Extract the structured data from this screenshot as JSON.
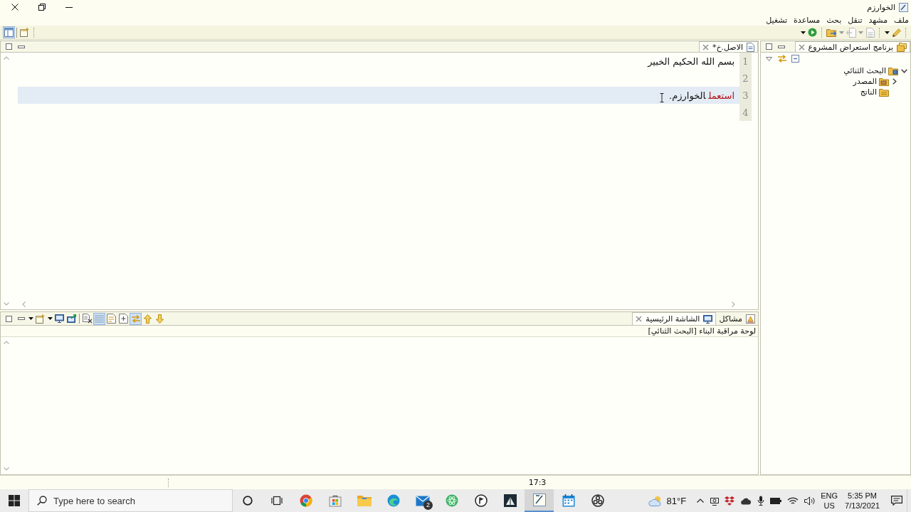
{
  "window": {
    "title": "الخوارزم"
  },
  "menu": [
    "ملف",
    "مشهد",
    "تنقل",
    "بحث",
    "مساعدة",
    "تشغيل"
  ],
  "toolbar": {
    "perspectives": [
      {
        "kind": "perspective-active",
        "pressed": true
      },
      {
        "kind": "perspective-open",
        "pressed": false
      }
    ],
    "groups": [
      {
        "items": [
          {
            "kind": "pencil",
            "disabled": false
          },
          {
            "kind": "caret",
            "disabled": false
          }
        ]
      },
      {
        "items": [
          {
            "kind": "page",
            "disabled": true
          },
          {
            "kind": "caret",
            "disabled": true
          },
          {
            "kind": "back",
            "disabled": true
          },
          {
            "kind": "caret",
            "disabled": true
          },
          {
            "kind": "folder-arrow",
            "disabled": false
          }
        ]
      },
      {
        "items": [
          {
            "kind": "run",
            "disabled": false
          },
          {
            "kind": "caret",
            "disabled": false
          }
        ]
      }
    ]
  },
  "editor": {
    "tabs": [
      {
        "label": "*الاصل.خ",
        "selected": true
      }
    ],
    "lines": [
      {
        "number": "1",
        "current": false,
        "tokens": [
          {
            "kind": "plain",
            "text": "بسم الله الحكيم الخبير"
          }
        ]
      },
      {
        "number": "2",
        "current": false
      },
      {
        "number": "3",
        "current": true,
        "tokens": [
          {
            "kind": "keyword",
            "text": "استعمل"
          },
          {
            "kind": "plain",
            "text": "الخوارزم."
          }
        ]
      },
      {
        "number": "4",
        "current": false
      }
    ]
  },
  "bottom_panel": {
    "toolbar": {
      "groups": [
        {
          "items": [
            {
              "kind": "caret",
              "pressed": false
            },
            {
              "kind": "new-console",
              "pressed": false
            },
            {
              "kind": "caret",
              "pressed": false
            },
            {
              "kind": "display",
              "pressed": false
            },
            {
              "kind": "open-console",
              "pressed": false
            }
          ]
        },
        {
          "items": [
            {
              "kind": "remove",
              "pressed": false
            },
            {
              "kind": "scroll-lock",
              "pressed": true
            },
            {
              "kind": "word-wrap",
              "pressed": false
            },
            {
              "kind": "pin",
              "pressed": false
            },
            {
              "kind": "link",
              "pressed": true
            },
            {
              "kind": "up",
              "pressed": false
            },
            {
              "kind": "down",
              "pressed": false
            }
          ]
        }
      ]
    },
    "tabs": [
      {
        "label": "مشاكل",
        "kind": "problems",
        "selected": false
      },
      {
        "label": "الشاشة الرئيسية",
        "kind": "console",
        "selected": true
      }
    ],
    "console_title": "لوحة مراقبة البناء [البحث الثنائي]"
  },
  "explorer": {
    "tabs": [
      {
        "label": "برنامج استعراض المشروع",
        "selected": true
      }
    ],
    "tree": [
      {
        "label": "البحث الثنائي",
        "kind": "project",
        "expandable": true,
        "expanded": true,
        "children": [
          {
            "label": "المصدر",
            "kind": "source-folder",
            "expandable": true,
            "expanded": false
          },
          {
            "label": "الناتج",
            "kind": "output-folder",
            "expandable": false,
            "expanded": false
          }
        ]
      }
    ]
  },
  "status_bar": {
    "position": "17:3"
  },
  "taskbar": {
    "search_placeholder": "Type here to search",
    "apps": [
      {
        "kind": "cortana",
        "active": false
      },
      {
        "kind": "task-view",
        "active": false
      },
      {
        "kind": "chrome",
        "active": false
      },
      {
        "kind": "store",
        "active": false
      },
      {
        "kind": "files",
        "active": false
      },
      {
        "kind": "edge",
        "active": false
      },
      {
        "kind": "mail",
        "active": false,
        "badge": "2"
      },
      {
        "kind": "atom",
        "active": false
      },
      {
        "kind": "coin",
        "active": false
      },
      {
        "kind": "reader",
        "active": false
      },
      {
        "kind": "ide",
        "active": true
      },
      {
        "kind": "calendar",
        "active": false
      },
      {
        "kind": "obs",
        "active": false
      }
    ],
    "weather": "81°F",
    "language": {
      "input": "ENG",
      "region": "US"
    },
    "clock": {
      "time": "5:35 PM",
      "date": "7/13/2021"
    }
  }
}
